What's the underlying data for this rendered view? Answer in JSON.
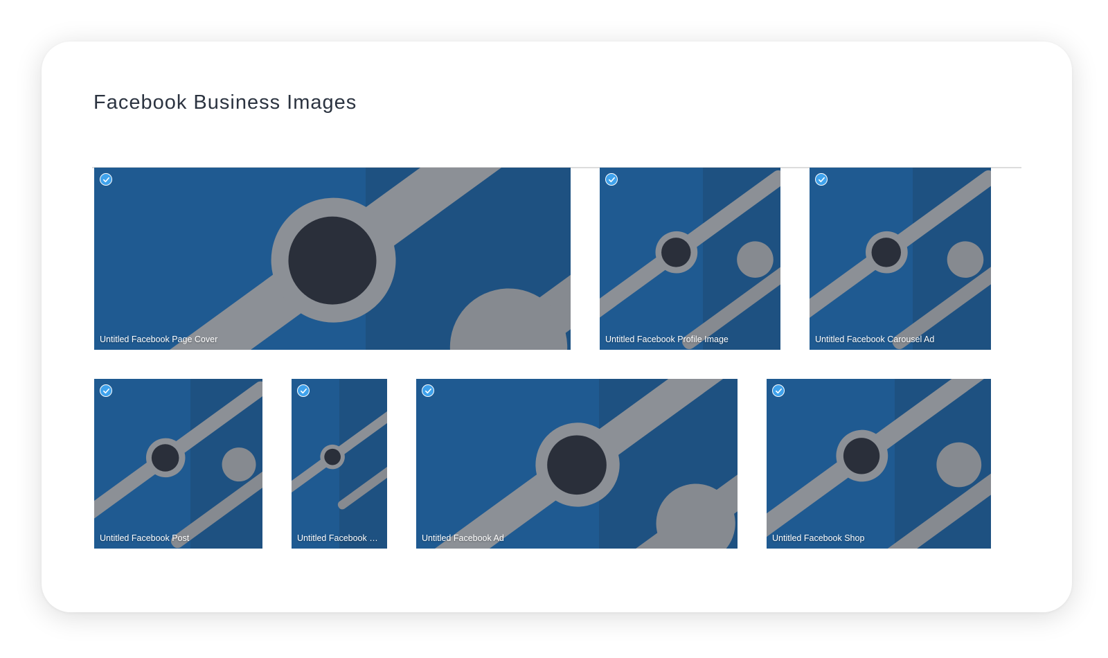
{
  "page": {
    "title": "Facebook Business Images"
  },
  "tiles": [
    {
      "label": "Untitled Facebook Page Cover",
      "selected": true,
      "icon": "checkmark-icon"
    },
    {
      "label": "Untitled Facebook Profile Image",
      "selected": true,
      "icon": "checkmark-icon"
    },
    {
      "label": "Untitled Facebook Carousel Ad",
      "selected": true,
      "icon": "checkmark-icon"
    },
    {
      "label": "Untitled Facebook Post",
      "selected": true,
      "icon": "checkmark-icon"
    },
    {
      "label": "Untitled Facebook St...",
      "selected": true,
      "icon": "checkmark-icon"
    },
    {
      "label": "Untitled Facebook Ad",
      "selected": true,
      "icon": "checkmark-icon"
    },
    {
      "label": "Untitled Facebook Shop",
      "selected": true,
      "icon": "checkmark-icon"
    }
  ],
  "colors": {
    "tile_background": "#1f5a91",
    "tile_shade": "#1e5181",
    "watch": "#8c9096",
    "check": "#3fa2ec"
  }
}
